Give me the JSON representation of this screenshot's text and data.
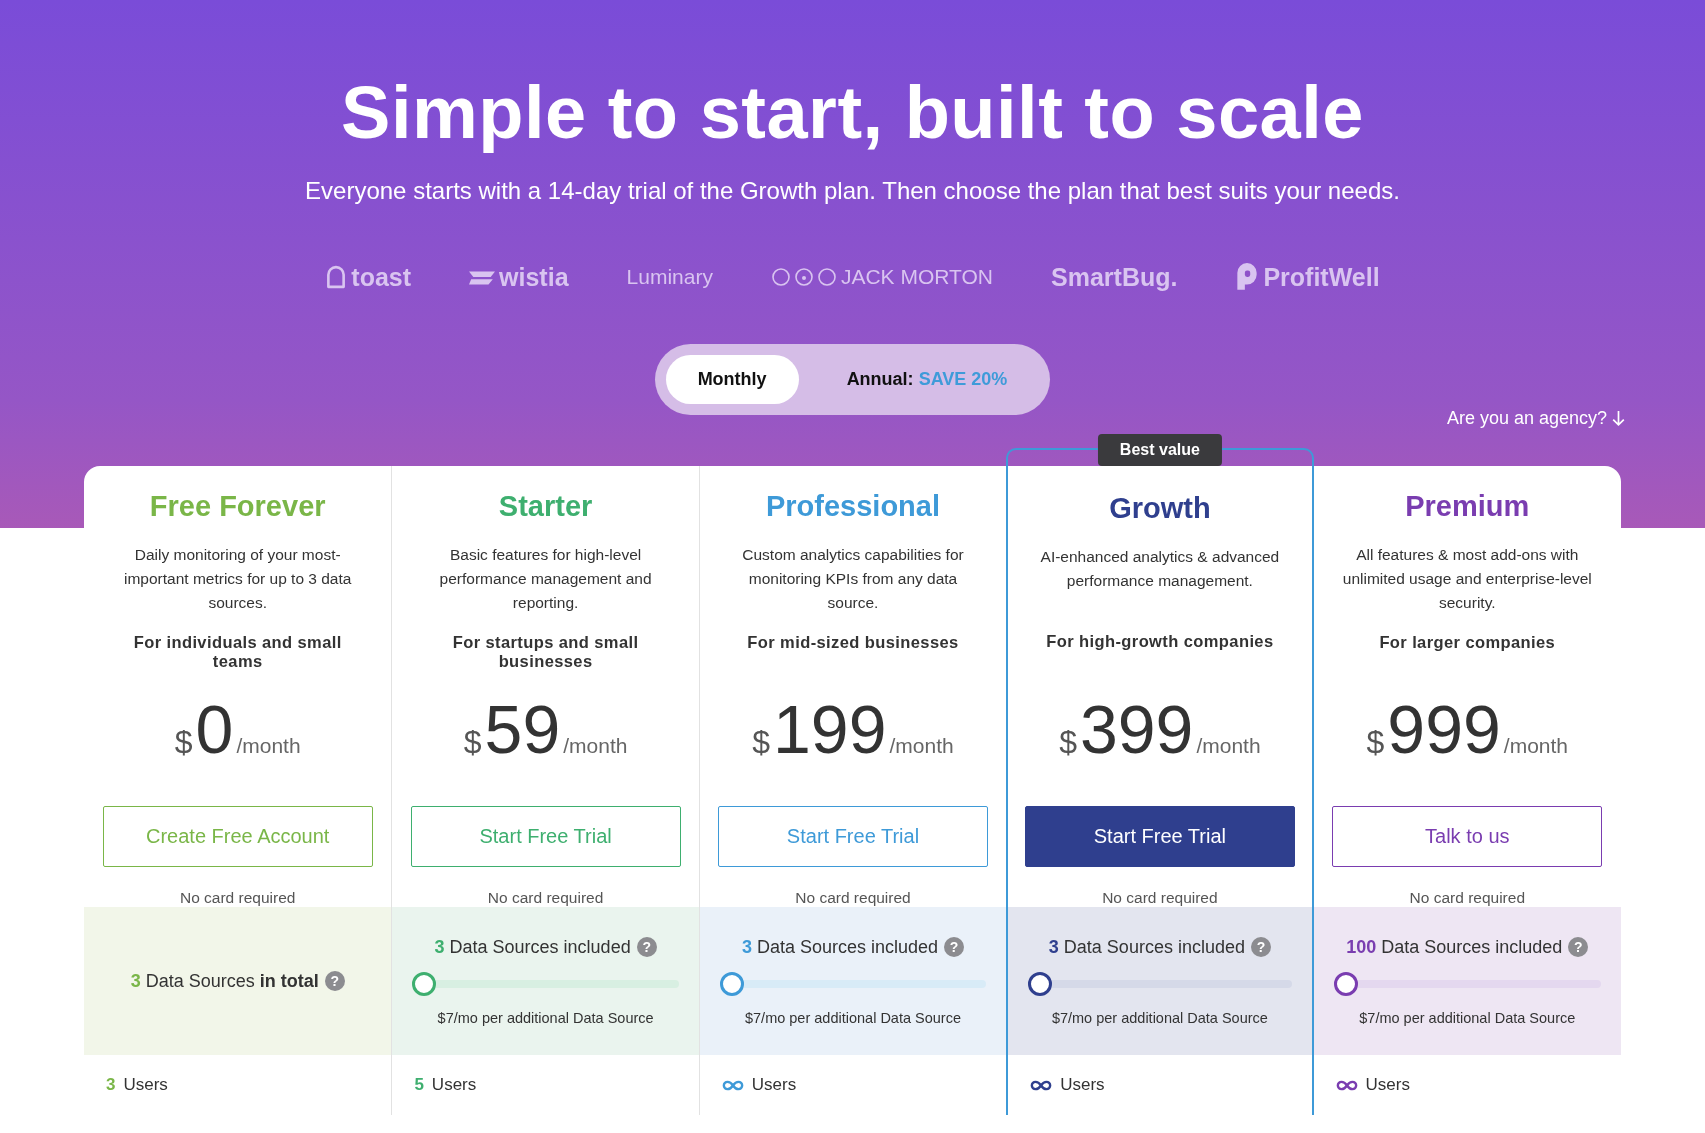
{
  "hero": {
    "title": "Simple to start, built to scale",
    "subtitle": "Everyone starts with a 14-day trial of the Growth plan. Then choose the plan that best suits your needs."
  },
  "logos": [
    {
      "kind": "toast",
      "label": "toast"
    },
    {
      "kind": "wistia",
      "label": "wistia"
    },
    {
      "kind": "plain",
      "label": "Luminary"
    },
    {
      "kind": "faces",
      "label": "JACK MORTON"
    },
    {
      "kind": "bold",
      "label": "SmartBug."
    },
    {
      "kind": "profitwell",
      "label": "ProfitWell"
    }
  ],
  "billing_toggle": [
    {
      "label": "Monthly",
      "selected": true
    },
    {
      "label": "Annual:",
      "highlight": "SAVE 20%",
      "selected": false
    }
  ],
  "agency_link": "Are you an agency?",
  "plans": [
    {
      "name": "Free Forever",
      "color": "#7ab648",
      "description": "Daily monitoring of your most-important metrics for up to 3 data sources.",
      "audience": "For individuals and small teams",
      "currency": "$",
      "price": "0",
      "period": "/month",
      "button": {
        "label": "Create Free Account",
        "filled": false
      },
      "note": "No card required",
      "sources": {
        "kind": "total",
        "count": "3",
        "text": "Data Sources **in total**",
        "help": "?"
      },
      "users": {
        "kind": "count",
        "count": "3",
        "label": "Users"
      }
    },
    {
      "name": "Starter",
      "color": "#3eaf6f",
      "description": "Basic features for high-level performance management and reporting.",
      "audience": "For startups and small businesses",
      "currency": "$",
      "price": "59",
      "period": "/month",
      "button": {
        "label": "Start Free Trial",
        "filled": false
      },
      "note": "No card required",
      "sources": {
        "kind": "slider",
        "count": "3",
        "text": "Data Sources included",
        "help": "?",
        "level": 0,
        "extra": "$7/mo per additional Data Source"
      },
      "users": {
        "kind": "count",
        "count": "5",
        "label": "Users"
      }
    },
    {
      "name": "Professional",
      "color": "#3e9ad8",
      "description": "Custom analytics capabilities for monitoring KPIs from any data source.",
      "audience": "For mid-sized businesses",
      "currency": "$",
      "price": "199",
      "period": "/month",
      "button": {
        "label": "Start Free Trial",
        "filled": false
      },
      "note": "No card required",
      "sources": {
        "kind": "slider",
        "count": "3",
        "text": "Data Sources included",
        "help": "?",
        "level": 0,
        "extra": "$7/mo per additional Data Source"
      },
      "users": {
        "kind": "unlimited",
        "label": "Users"
      }
    },
    {
      "name": "Growth",
      "color": "#2f3f8e",
      "badge": "Best value",
      "description": "AI-enhanced analytics & advanced performance management.",
      "audience": "For high-growth companies",
      "currency": "$",
      "price": "399",
      "period": "/month",
      "button": {
        "label": "Start Free Trial",
        "filled": true
      },
      "note": "No card required",
      "sources": {
        "kind": "slider",
        "count": "3",
        "text": "Data Sources included",
        "help": "?",
        "level": 0,
        "extra": "$7/mo per additional Data Source"
      },
      "users": {
        "kind": "unlimited",
        "label": "Users"
      }
    },
    {
      "name": "Premium",
      "color": "#7a3db0",
      "description": "All features & most add-ons with unlimited usage and enterprise-level security.",
      "audience": "For larger companies",
      "currency": "$",
      "price": "999",
      "period": "/month",
      "button": {
        "label": "Talk to us",
        "filled": false
      },
      "note": "No card required",
      "sources": {
        "kind": "slider",
        "count": "100",
        "text": "Data Sources included",
        "help": "?",
        "level": 0,
        "extra": "$7/mo per additional Data Source"
      },
      "users": {
        "kind": "unlimited",
        "label": "Users"
      }
    }
  ]
}
